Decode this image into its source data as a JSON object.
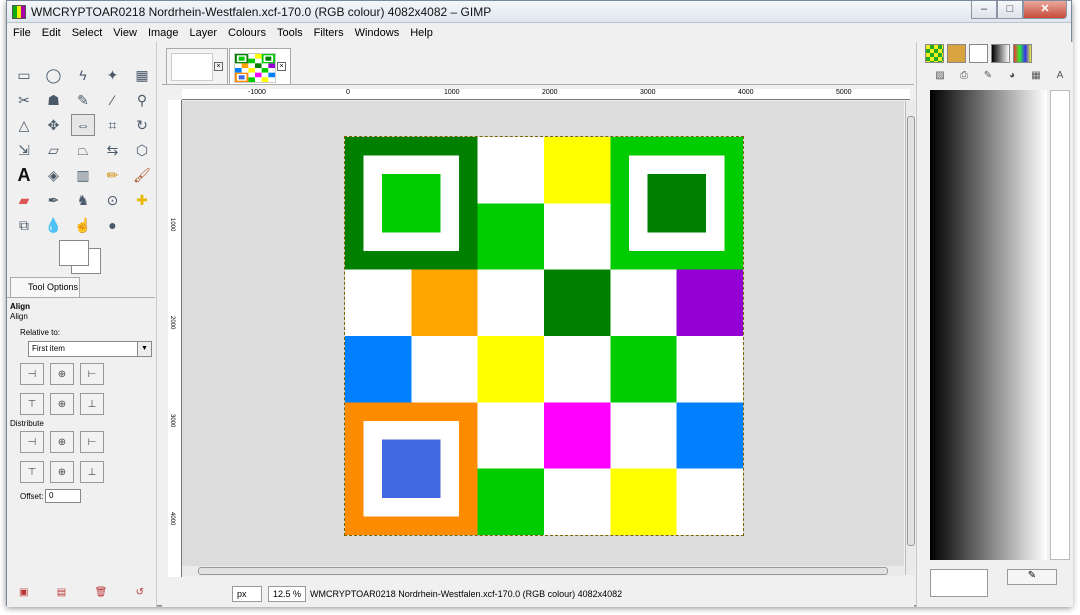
{
  "window": {
    "title": "WMCRYPTOAR0218 Nordrhein-Westfalen.xcf-170.0 (RGB colour) 4082x4082 – GIMP",
    "buttons": {
      "minimize": "–",
      "maximize": "□",
      "close": "✕"
    }
  },
  "menu": [
    "File",
    "Edit",
    "Select",
    "View",
    "Image",
    "Layer",
    "Colours",
    "Tools",
    "Filters",
    "Windows",
    "Help"
  ],
  "tool_options": {
    "tab_label": "Tool Options",
    "title": "Align",
    "subtitle": "Align",
    "relative_to_label": "Relative to:",
    "relative_to_value": "First item",
    "distribute_label": "Distribute",
    "offset_label": "Offset:",
    "offset_value": "0"
  },
  "ruler": {
    "h_labels": [
      "-1000",
      "0",
      "1000",
      "2000",
      "3000",
      "4000",
      "5000"
    ],
    "v_labels": [
      "1000",
      "2000",
      "3000",
      "4000"
    ]
  },
  "status": {
    "unit": "px",
    "zoom": "12.5 %",
    "text": "WMCRYPTOAR0218 Nordrhein-Westfalen.xcf-170.0 (RGB colour) 4082x4082"
  },
  "colors": {
    "dark_green": "#008000",
    "green": "#00cc00",
    "yellow": "#ffff00",
    "orange_light": "#ffa500",
    "orange": "#ff8c00",
    "purple": "#9400d3",
    "blue": "#0080ff",
    "royal_blue": "#4169e1",
    "magenta": "#ff00ff",
    "white": "#ffffff"
  },
  "image_grid": [
    [
      "F",
      "F",
      "white",
      "yellow",
      "F",
      "F"
    ],
    [
      "F",
      "F",
      "green",
      "white",
      "F",
      "F"
    ],
    [
      "white",
      "orange_light",
      "white",
      "dark_green",
      "white",
      "purple"
    ],
    [
      "blue",
      "white",
      "yellow",
      "white",
      "green",
      "white"
    ],
    [
      "F",
      "F",
      "white",
      "magenta",
      "white",
      "blue"
    ],
    [
      "F",
      "F",
      "green",
      "white",
      "yellow",
      "white"
    ]
  ],
  "finders": [
    {
      "row": 0,
      "col": 0,
      "outer": "dark_green",
      "inner": "green"
    },
    {
      "row": 0,
      "col": 4,
      "outer": "green",
      "inner": "dark_green"
    },
    {
      "row": 4,
      "col": 0,
      "outer": "orange",
      "inner": "royal_blue"
    }
  ]
}
